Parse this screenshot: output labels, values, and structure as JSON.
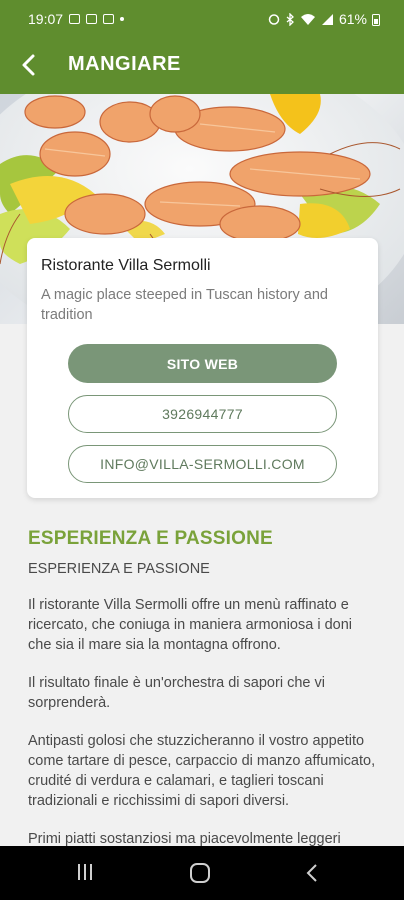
{
  "status_bar": {
    "time": "19:07",
    "battery": "61%"
  },
  "app_bar": {
    "title": "MANGIARE"
  },
  "restaurant": {
    "name": "Ristorante Villa Sermolli",
    "description": "A magic place steeped in Tuscan history and tradition",
    "website_label": "SITO WEB",
    "phone": "3926944777",
    "email": "INFO@VILLA-SERMOLLI.COM"
  },
  "content": {
    "section_title": "ESPERIENZA E PASSIONE",
    "subtitle": "ESPERIENZA E PASSIONE",
    "paragraphs": [
      "Il ristorante Villa Sermolli offre un menù raffinato e ricercato, che coniuga in maniera armoniosa i doni che sia il mare sia la montagna offrono.",
      "Il risultato finale è un'orchestra di sapori che vi sorprenderà.",
      "Antipasti golosi che stuzzicheranno il vostro appetito come tartare di pesce, carpaccio di manzo affumicato, crudité di verdura e calamari, e taglieri toscani tradizionali e ricchissimi di sapori diversi.",
      "Primi piatti sostanziosi ma piacevolmente leggeri"
    ]
  },
  "colors": {
    "primary": "#5f8d2e",
    "accent_title": "#7aa23a",
    "button": "#7a9678"
  },
  "icons": {
    "back": "arrow-back-icon",
    "nav_recent": "recent-apps-icon",
    "nav_home": "home-icon",
    "nav_back": "nav-back-icon"
  }
}
